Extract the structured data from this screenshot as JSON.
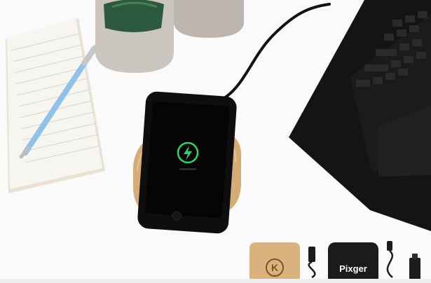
{
  "image": {
    "kind": "product-photo",
    "phone_screen_text": "",
    "thumbnails": [
      {
        "brand": "K",
        "color": "#d9b27e"
      },
      {
        "brand": "Pixger",
        "color": "#1b1b1b"
      }
    ],
    "colors": {
      "background": "#ffffff",
      "bamboo": "#d6ac76",
      "phone": "#0e0e0e",
      "charge_green": "#2fd36b",
      "laptop": "#161616",
      "pen": "#8fc2e6",
      "notepad": "#f4f1ea",
      "pot": "#cfc8c2"
    }
  }
}
